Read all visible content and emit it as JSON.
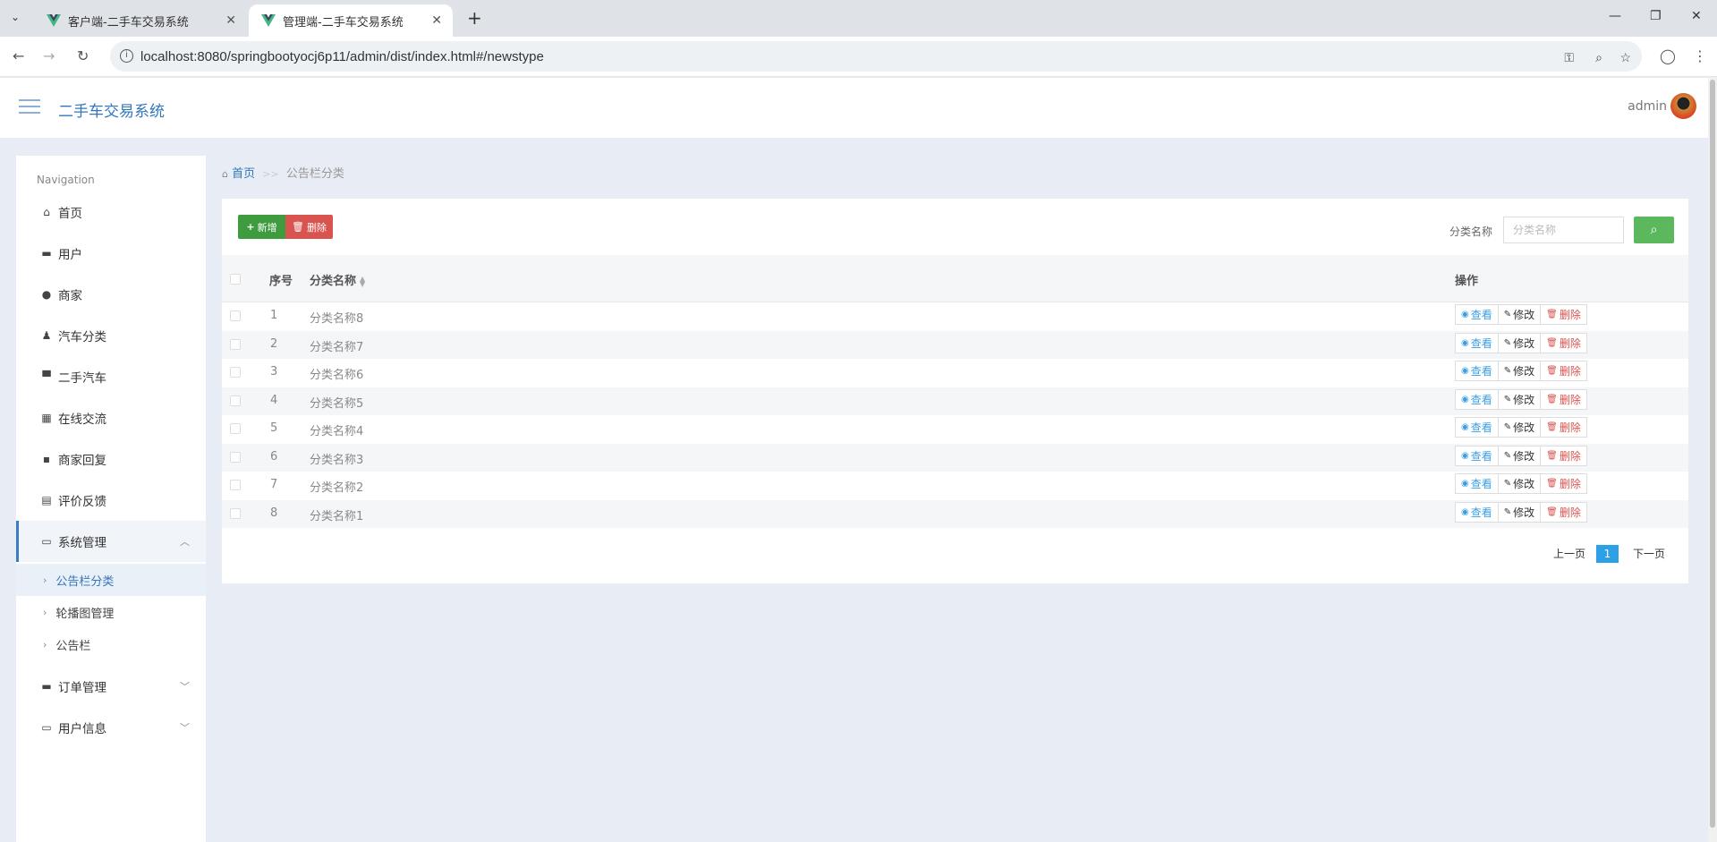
{
  "browser": {
    "tabs": [
      {
        "title": "客户端-二手车交易系统"
      },
      {
        "title": "管理端-二手车交易系统"
      }
    ],
    "url": "localhost:8080/springbootyocj6p11/admin/dist/index.html#/newstype"
  },
  "header": {
    "title": "二手车交易系统",
    "user": "admin"
  },
  "sidebar": {
    "nav_title": "Navigation",
    "items": [
      {
        "label": "首页",
        "icon": "home-icon"
      },
      {
        "label": "用户",
        "icon": "briefcase-icon"
      },
      {
        "label": "商家",
        "icon": "leaf-icon"
      },
      {
        "label": "汽车分类",
        "icon": "user-icon"
      },
      {
        "label": "二手汽车",
        "icon": "paint-roller-icon"
      },
      {
        "label": "在线交流",
        "icon": "grid-icon"
      },
      {
        "label": "商家回复",
        "icon": "comment-icon"
      },
      {
        "label": "评价反馈",
        "icon": "clipboard-icon"
      },
      {
        "label": "系统管理",
        "icon": "inbox-icon"
      },
      {
        "label": "订单管理",
        "icon": "monitor-icon"
      },
      {
        "label": "用户信息",
        "icon": "card-icon"
      }
    ],
    "sub_items": [
      {
        "label": "公告栏分类"
      },
      {
        "label": "轮播图管理"
      },
      {
        "label": "公告栏"
      }
    ]
  },
  "breadcrumb": {
    "home": "首页",
    "sep": ">>",
    "current": "公告栏分类"
  },
  "toolbar": {
    "add_label": "新增",
    "delete_label": "删除"
  },
  "search": {
    "label": "分类名称",
    "placeholder": "分类名称"
  },
  "table": {
    "headers": {
      "no": "序号",
      "name": "分类名称",
      "ops": "操作"
    },
    "rows": [
      {
        "no": "1",
        "name": "分类名称8"
      },
      {
        "no": "2",
        "name": "分类名称7"
      },
      {
        "no": "3",
        "name": "分类名称6"
      },
      {
        "no": "4",
        "name": "分类名称5"
      },
      {
        "no": "5",
        "name": "分类名称4"
      },
      {
        "no": "6",
        "name": "分类名称3"
      },
      {
        "no": "7",
        "name": "分类名称2"
      },
      {
        "no": "8",
        "name": "分类名称1"
      }
    ],
    "actions": {
      "view": "查看",
      "edit": "修改",
      "remove": "删除"
    }
  },
  "pagination": {
    "prev": "上一页",
    "current": "1",
    "next": "下一页"
  },
  "colors": {
    "brand": "#3377bb",
    "add": "#3e9b3e",
    "delete": "#d9534f",
    "search": "#5cb85c",
    "page_active": "#2ea1e6"
  }
}
